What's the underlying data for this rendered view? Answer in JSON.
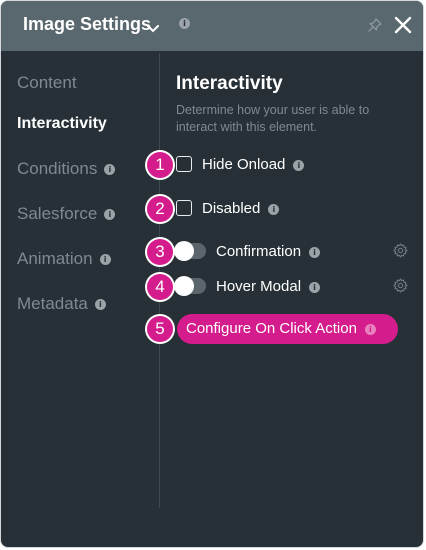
{
  "header": {
    "title": "Image Settings",
    "info_glyph": "i"
  },
  "sidebar": {
    "items": [
      {
        "label": "Content",
        "active": false,
        "info": false
      },
      {
        "label": "Interactivity",
        "active": true,
        "info": false
      },
      {
        "label": "Conditions",
        "active": false,
        "info": true
      },
      {
        "label": "Salesforce",
        "active": false,
        "info": true
      },
      {
        "label": "Animation",
        "active": false,
        "info": true
      },
      {
        "label": "Metadata",
        "active": false,
        "info": true
      }
    ]
  },
  "main": {
    "title": "Interactivity",
    "description": "Determine how your user is able to interact with this element.",
    "options": [
      {
        "marker": "1",
        "label": "Hide Onload",
        "control": "checkbox",
        "checked": false
      },
      {
        "marker": "2",
        "label": "Disabled",
        "control": "checkbox",
        "checked": false
      },
      {
        "marker": "3",
        "label": "Confirmation",
        "control": "toggle",
        "on": false,
        "settings_icon": "gear-icon"
      },
      {
        "marker": "4",
        "label": "Hover Modal",
        "control": "toggle",
        "on": false,
        "settings_icon": "gear-icon"
      }
    ],
    "action": {
      "marker": "5",
      "label": "Configure On Click Action"
    }
  },
  "icons": {
    "dropdown": "chevron-down-icon",
    "pin": "pin-icon",
    "close": "close-icon",
    "info": "info-icon",
    "settings": "gear-icon"
  },
  "colors": {
    "panel_bg": "#263036",
    "header_bg": "#59676f",
    "accent": "#d41c8c",
    "muted_text": "#7e8a90"
  }
}
